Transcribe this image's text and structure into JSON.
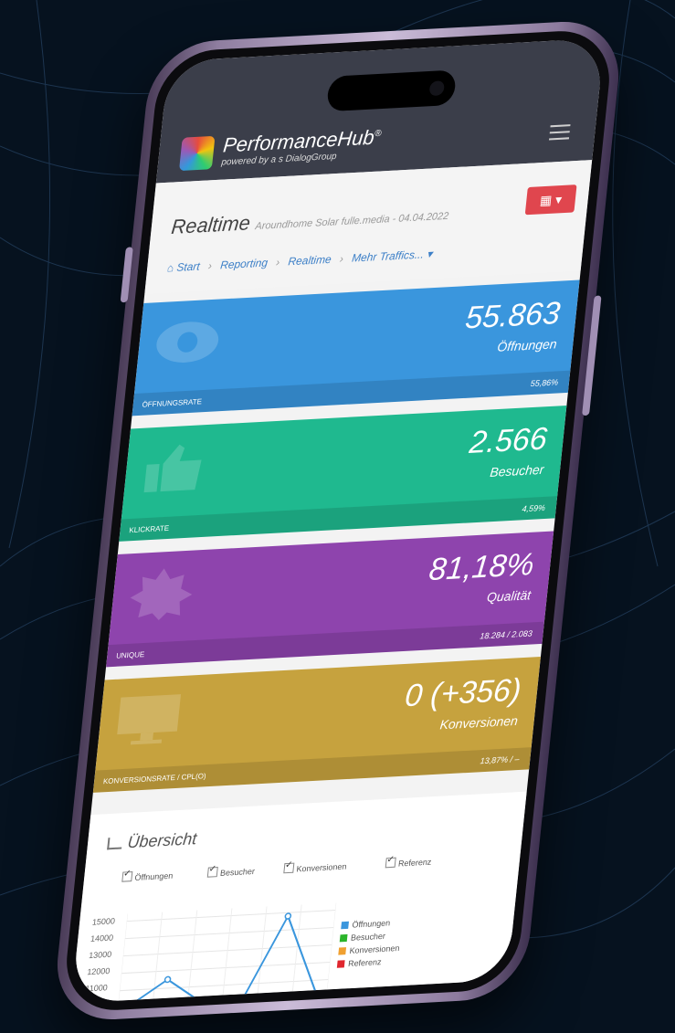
{
  "header": {
    "brand": "PerformanceHub",
    "brand_mark": "®",
    "brand_sub": "powered by a s DialogGroup"
  },
  "page": {
    "title": "Realtime",
    "subtitle": "Aroundhome Solar fulle.media - 04.04.2022",
    "calendar_icon": "calendar-icon"
  },
  "breadcrumb": [
    "Start",
    "Reporting",
    "Realtime",
    "Mehr Traffics..."
  ],
  "cards": [
    {
      "value": "55.863",
      "caption": "Öffnungen",
      "foot_label": "ÖFFNUNGSRATE",
      "foot_value": "55,86%",
      "color": "#3a96dd",
      "icon": "eye-icon"
    },
    {
      "value": "2.566",
      "caption": "Besucher",
      "foot_label": "KLICKRATE",
      "foot_value": "4,59%",
      "color": "#1fb98f",
      "icon": "thumbs-up-icon"
    },
    {
      "value": "81,18%",
      "caption": "Qualität",
      "foot_label": "UNIQUE",
      "foot_value": "18.284 / 2.083",
      "color": "#8e44ad",
      "icon": "badge-icon"
    },
    {
      "value": "0 (+356)",
      "caption": "Konversionen",
      "foot_label": "KONVERSIONSRATE / CPL(O)",
      "foot_value": "13,87% / –",
      "color": "#c6a23e",
      "icon": "monitor-icon"
    }
  ],
  "overview": {
    "title": "Übersicht",
    "toggles": [
      "Öffnungen",
      "Besucher",
      "Konversionen",
      "Referenz"
    ]
  },
  "chart_data": {
    "type": "line",
    "title": "",
    "xlabel": "",
    "ylabel": "",
    "yticks": [
      "15000",
      "14000",
      "13000",
      "12000",
      "11000"
    ],
    "ylim": [
      10000,
      15000
    ],
    "series": [
      {
        "name": "Öffnungen",
        "color": "#3a96dd",
        "values": [
          10000,
          11500,
          10000,
          10000,
          14800,
          10000
        ]
      },
      {
        "name": "Besucher",
        "color": "#2bb52b",
        "values": []
      },
      {
        "name": "Konversionen",
        "color": "#f0a030",
        "values": []
      },
      {
        "name": "Referenz",
        "color": "#e0262e",
        "values": []
      }
    ],
    "legend": "right",
    "grid": true
  }
}
